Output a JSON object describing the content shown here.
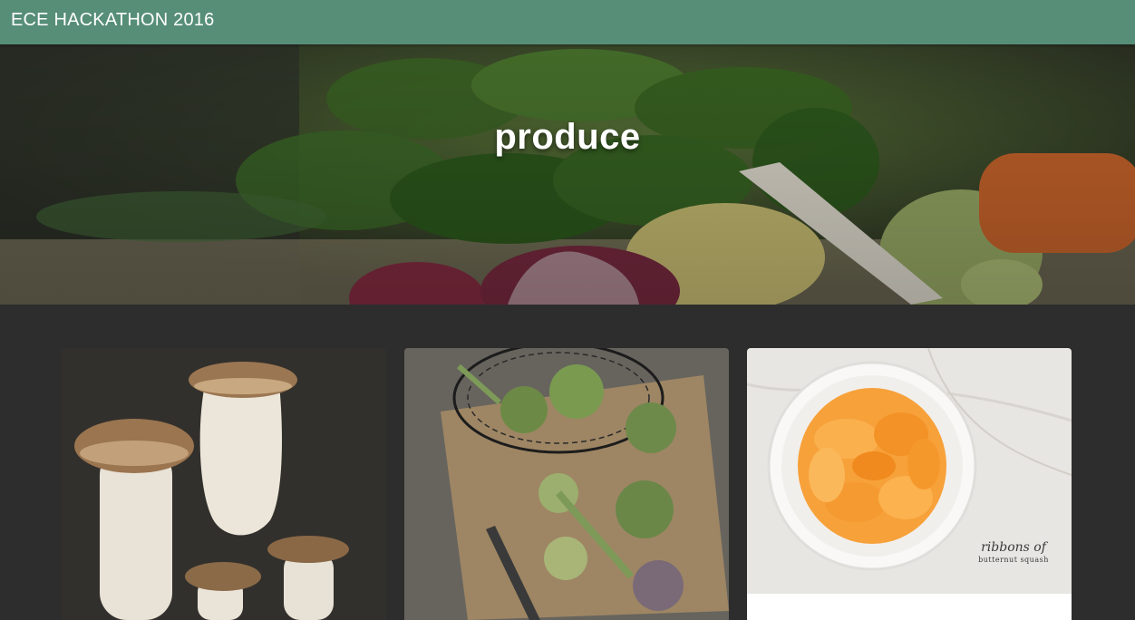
{
  "navbar": {
    "brand": "ECE HACKATHON 2016",
    "color": "#568e78"
  },
  "hero": {
    "title": "produce",
    "image": "leafy-greens-vegetables-photo"
  },
  "cards": [
    {
      "image": "king-oyster-mushrooms-photo"
    },
    {
      "image": "artichokes-on-burlap-photo"
    },
    {
      "image": "butternut-squash-ribbons-photo",
      "label_line1": "ribbons of",
      "label_line2": "butternut squash"
    }
  ]
}
